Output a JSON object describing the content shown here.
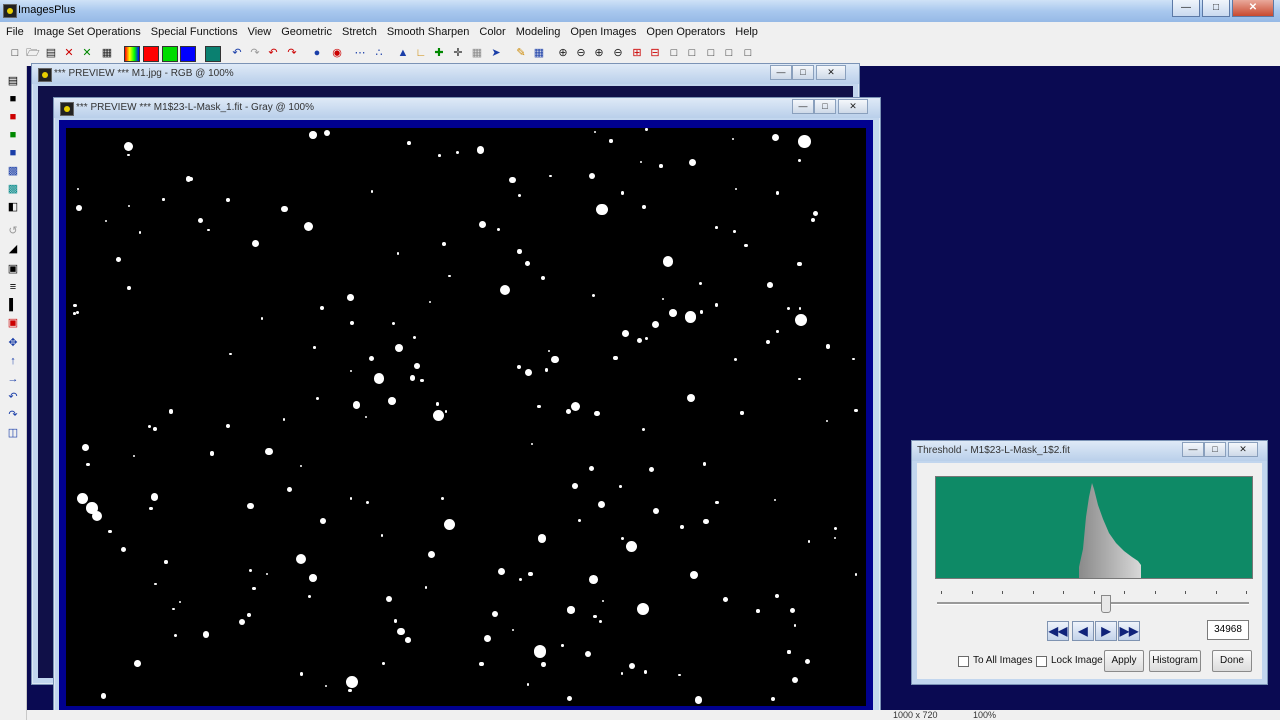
{
  "app": {
    "title": "ImagesPlus"
  },
  "menu": [
    "File",
    "Image Set Operations",
    "Special Functions",
    "View",
    "Geometric",
    "Stretch",
    "Smooth Sharpen",
    "Color",
    "Modeling",
    "Open Images",
    "Open Operators",
    "Help"
  ],
  "window_back": {
    "title": "*** PREVIEW *** M1.jpg - RGB @ 100%"
  },
  "window_front": {
    "title": "*** PREVIEW *** M1$23-L-Mask_1.fit - Gray @ 100%"
  },
  "threshold": {
    "title": "Threshold - M1$23-L-Mask_1$2.fit",
    "value": "34968",
    "slider_level": 0.54,
    "checkbox_all": "To All Images",
    "checkbox_lock": "Lock Image",
    "apply": "Apply",
    "histogram": "Histogram",
    "done": "Done",
    "histo_color": "#0e8a66"
  },
  "status": {
    "size": "1000 x 720",
    "zoom": "100%"
  },
  "colors": {
    "workspace": "#0a0a52",
    "frame": "#00008f",
    "accent": "#1a3ea8"
  }
}
